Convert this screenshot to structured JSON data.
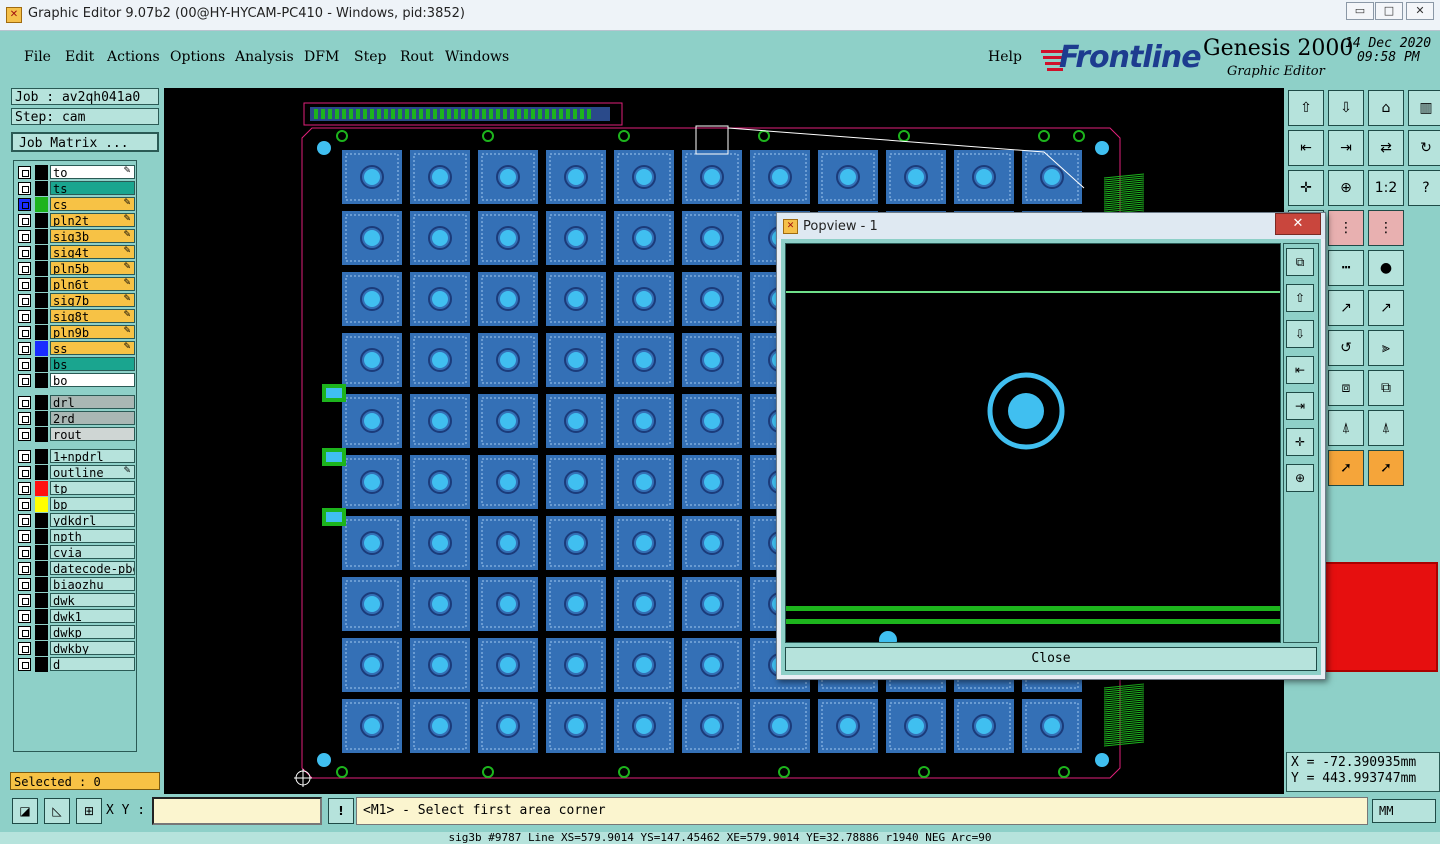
{
  "window": {
    "title": "Graphic Editor 9.07b2 (00@HY-HYCAM-PC410 - Windows, pid:3852)",
    "minimize": "▭",
    "maximize": "□",
    "close": "✕"
  },
  "menu": [
    {
      "label": "File"
    },
    {
      "label": "Edit"
    },
    {
      "label": "Actions"
    },
    {
      "label": "Options"
    },
    {
      "label": "Analysis"
    },
    {
      "label": "DFM"
    },
    {
      "label": "Step"
    },
    {
      "label": "Rout"
    },
    {
      "label": "Windows"
    },
    {
      "label": "Help"
    }
  ],
  "brand": {
    "logo": "Frontline",
    "product": "Genesis 2000",
    "subtitle": "Graphic Editor",
    "date": "14 Dec 2020",
    "time": "09:58 PM"
  },
  "job": {
    "job_label": "Job : av2qh041a0",
    "step_label": "Step: cam",
    "matrix_button": "Job Matrix ..."
  },
  "layers": [
    {
      "name": "to",
      "color": "#000000",
      "bg": "#ffffff",
      "editable": true
    },
    {
      "name": "ts",
      "color": "#000000",
      "bg": "#1aa58f",
      "editable": false
    },
    {
      "name": "cs",
      "color": "#1db41d",
      "bg": "#f7c245",
      "editable": true,
      "active": true
    },
    {
      "name": "pln2t",
      "color": "#000000",
      "bg": "#f7c245",
      "editable": true
    },
    {
      "name": "sig3b",
      "color": "#000000",
      "bg": "#f7c245",
      "editable": true
    },
    {
      "name": "sig4t",
      "color": "#000000",
      "bg": "#f7c245",
      "editable": true
    },
    {
      "name": "pln5b",
      "color": "#000000",
      "bg": "#f7c245",
      "editable": true
    },
    {
      "name": "pln6t",
      "color": "#000000",
      "bg": "#f7c245",
      "editable": true
    },
    {
      "name": "sig7b",
      "color": "#000000",
      "bg": "#f7c245",
      "editable": true
    },
    {
      "name": "sig8t",
      "color": "#000000",
      "bg": "#f7c245",
      "editable": true
    },
    {
      "name": "pln9b",
      "color": "#000000",
      "bg": "#f7c245",
      "editable": true
    },
    {
      "name": "ss",
      "color": "#1a2cff",
      "bg": "#f7c245",
      "editable": true
    },
    {
      "name": "bs",
      "color": "#000000",
      "bg": "#1aa58f",
      "editable": false
    },
    {
      "name": "bo",
      "color": "#000000",
      "bg": "#ffffff",
      "editable": false
    },
    {
      "name": "drl",
      "color": "#000000",
      "bg": "#a9b7b4",
      "editable": false,
      "gap": true
    },
    {
      "name": "2rd",
      "color": "#000000",
      "bg": "#a9b7b4",
      "editable": false
    },
    {
      "name": "rout",
      "color": "#000000",
      "bg": "#cfd6d4",
      "editable": false
    },
    {
      "name": "1+npdrl",
      "color": "#000000",
      "bg": "#b6e3dc",
      "editable": false,
      "gap": true
    },
    {
      "name": "outline",
      "color": "#000000",
      "bg": "#b6e3dc",
      "editable": true
    },
    {
      "name": "tp",
      "color": "#ff1010",
      "bg": "#b6e3dc",
      "editable": false
    },
    {
      "name": "bp",
      "color": "#ffff00",
      "bg": "#b6e3dc",
      "editable": false
    },
    {
      "name": "ydkdrl",
      "color": "#000000",
      "bg": "#b6e3dc",
      "editable": false
    },
    {
      "name": "npth",
      "color": "#000000",
      "bg": "#b6e3dc",
      "editable": false
    },
    {
      "name": "cvia",
      "color": "#000000",
      "bg": "#b6e3dc",
      "editable": false
    },
    {
      "name": "datecode-pbe",
      "color": "#000000",
      "bg": "#b6e3dc",
      "editable": false
    },
    {
      "name": "biaozhu",
      "color": "#000000",
      "bg": "#b6e3dc",
      "editable": false
    },
    {
      "name": "dwk",
      "color": "#000000",
      "bg": "#b6e3dc",
      "editable": false
    },
    {
      "name": "dwk1",
      "color": "#000000",
      "bg": "#b6e3dc",
      "editable": false
    },
    {
      "name": "dwkp",
      "color": "#000000",
      "bg": "#b6e3dc",
      "editable": false
    },
    {
      "name": "dwkby",
      "color": "#000000",
      "bg": "#b6e3dc",
      "editable": false
    },
    {
      "name": "d",
      "color": "#000000",
      "bg": "#b6e3dc",
      "editable": false
    }
  ],
  "selected": "Selected : 0",
  "coords": {
    "x": "X = -72.390935mm",
    "y": "Y = 443.993747mm"
  },
  "bottom": {
    "xy_label": "X Y :",
    "xy_value": "",
    "warn": "!",
    "prompt": "<M1> - Select first area corner",
    "units": "MM",
    "status": "sig3b #9787 Line XS=579.9014 YS=147.45462 XE=579.9014 YE=32.78886 r1940 NEG Arc=90"
  },
  "popview": {
    "title": "Popview - 1",
    "close_x": "✕",
    "close_button": "Close"
  },
  "toolbar_icons": [
    "home-up-icon",
    "home-down-icon",
    "house-icon",
    "panel-icon",
    "zoom-back-icon",
    "zoom-forward-icon",
    "toggle-icon",
    "redraw-icon",
    "fit-icon",
    "center-icon",
    "one-to-one-icon",
    "help-query-icon",
    "snap-icon",
    "net-icon",
    "net-b-icon",
    "",
    "measure-icon",
    "ruler-icon",
    "pad-icon",
    "",
    "cross-icon",
    "pointer-a-icon",
    "pointer-b-icon",
    "",
    "line-icon",
    "arc-icon",
    "filter-icon",
    "",
    "minus-icon",
    "pad-box-icon",
    "group-icon",
    "",
    "arrow-a-icon",
    "arrow-b-icon",
    "arrow-c-icon",
    "",
    "select-icon",
    "select-b-icon",
    "select-c-icon",
    ""
  ],
  "colors": {
    "panel": "#8ed0c8",
    "pcb_blue": "#3d84d6",
    "pcb_via": "#40bff0",
    "pcb_green": "#1db41d",
    "outline": "#e0207a"
  }
}
